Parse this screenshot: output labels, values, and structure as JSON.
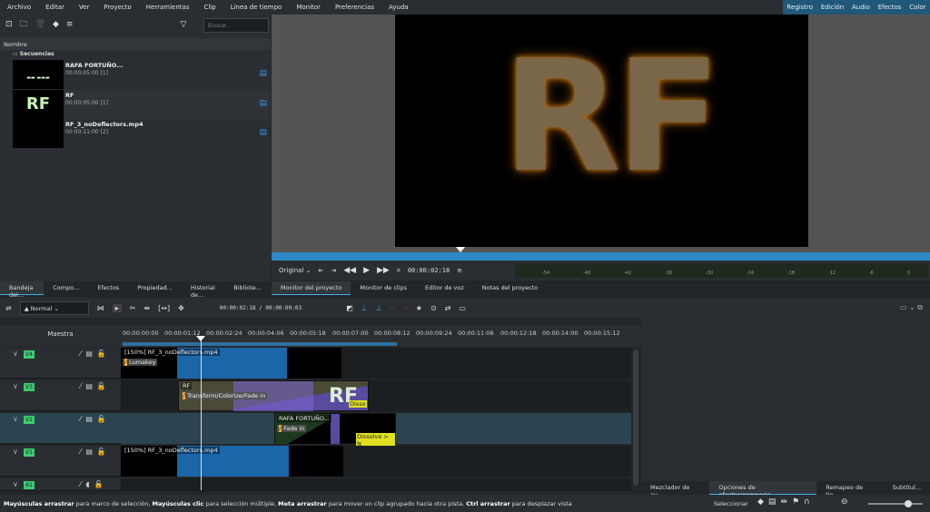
{
  "menu": [
    "Archivo",
    "Editar",
    "Ver",
    "Proyecto",
    "Herramientas",
    "Clip",
    "Línea de tiempo",
    "Monitor",
    "Preferencias",
    "Ayuda"
  ],
  "workspaces": [
    "Registro",
    "Edición",
    "Audio",
    "Efectos",
    "Color"
  ],
  "bin": {
    "search_placeholder": "Buscar...",
    "column": "Nombre",
    "folder": "Secuencias",
    "items": [
      {
        "name": "RAFA FORTUÑO...",
        "duration": "00:00:05:00 [1]"
      },
      {
        "name": "RF",
        "duration": "00:00:05:00 [1]",
        "thumb": "RF"
      },
      {
        "name": "RF_3_noDeflectors.mp4",
        "duration": "00:00:11:00 [2]"
      }
    ]
  },
  "monitor": {
    "video_text": "RF",
    "zoom": "Original",
    "timecode": "00:00:02:18",
    "meter_ticks": [
      "-54",
      "-48",
      "-42",
      "-36",
      "-30",
      "-24",
      "-18",
      "-12",
      "-6",
      "0"
    ]
  },
  "left_tabs": [
    "Bandeja del...",
    "Compo...",
    "Efectos",
    "Propiedad...",
    "Historial de...",
    "Bibliote..."
  ],
  "monitor_tabs": [
    "Monitor del proyecto",
    "Monitor de clips",
    "Editor de voz",
    "Notas del proyecto"
  ],
  "timeline": {
    "mode": "Normal",
    "position": "00:00:02:18 / 00:00:09:03",
    "master": "Maestra",
    "ticks": [
      "00:00:00:00",
      "00:00:01:12",
      "00:00:02:24",
      "00:00:04:06",
      "00:00:05:18",
      "00:00:07:00",
      "00:00:08:12",
      "00:00:09:24",
      "00:00:11:06",
      "00:00:12:18",
      "00:00:14:00",
      "00:00:15:12"
    ],
    "tracks": [
      "V4",
      "V3",
      "V2",
      "V1",
      "A1"
    ],
    "clips": {
      "v4_name": "[150%] RF_3_noDeflectors.mp4",
      "v4_fx": "Lumakey",
      "v3_name": "RF",
      "v3_fx": "Transform/Colorize/Fade in",
      "v3_thumb": "RF",
      "v3_trans": "Disso",
      "v2_name": "RAFA FORTUÑO...",
      "v2_fx": "Fade in",
      "v2_trans": "Dissolve > N",
      "v1_name": "[150%] RF_3_noDeflectors.mp4"
    }
  },
  "right_tabs": [
    "Mezclador de au...",
    "Opciones de efectos/composic...",
    "Remapeo de tie...",
    "Subtítul..."
  ],
  "status": {
    "parts": [
      [
        "Mayúsculas arrastrar",
        " para marco de selección, "
      ],
      [
        "Mayúsculas clic",
        " para selección múltiple, "
      ],
      [
        "Meta arrastrar",
        " para mover un clip agrupado hacia otra pista, "
      ],
      [
        "Ctrl arrastrar",
        " para desplazar vista"
      ]
    ],
    "select": "Seleccionar"
  },
  "colors": {
    "accent": "#3daee9",
    "workspace_bar": "#1f5878",
    "clip_blue": "#1a66a8",
    "track_green": "#3ccb6d"
  }
}
